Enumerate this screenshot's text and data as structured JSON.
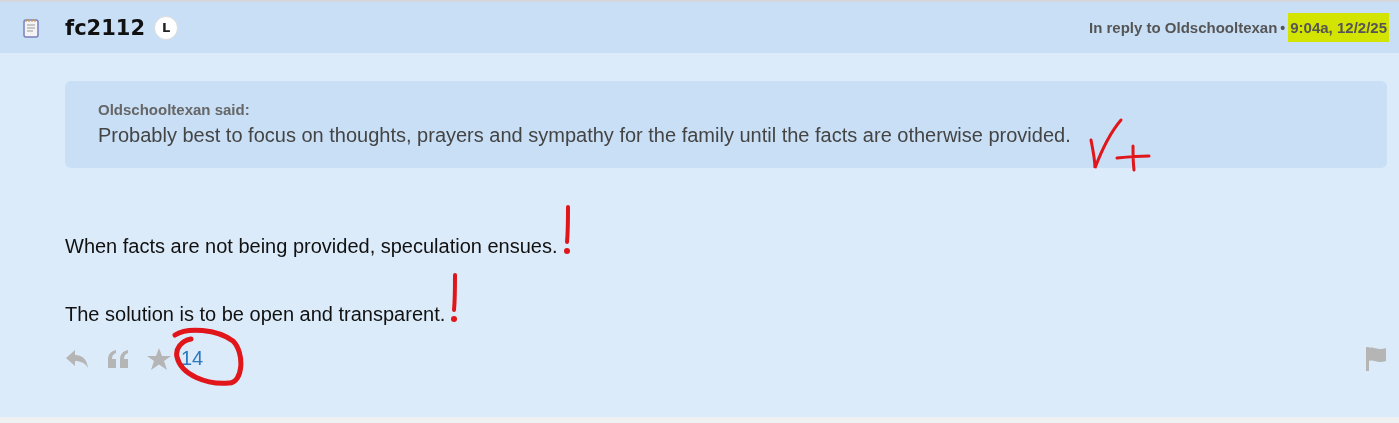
{
  "post": {
    "author": "fc2112",
    "badge": "L",
    "reply_to": "In reply to Oldschooltexan",
    "separator": "•",
    "timestamp": {
      "text": "9:04a, 12/2/25",
      "highlighted": true
    }
  },
  "quote": {
    "attribution": "Oldschooltexan said:",
    "text": "Probably best to focus on thoughts, prayers and sympathy for the family until the facts are otherwise provided."
  },
  "paragraphs": [
    "When facts are not being provided, speculation ensues.",
    "The solution is to be open and transparent."
  ],
  "reactions": {
    "count": "14"
  }
}
